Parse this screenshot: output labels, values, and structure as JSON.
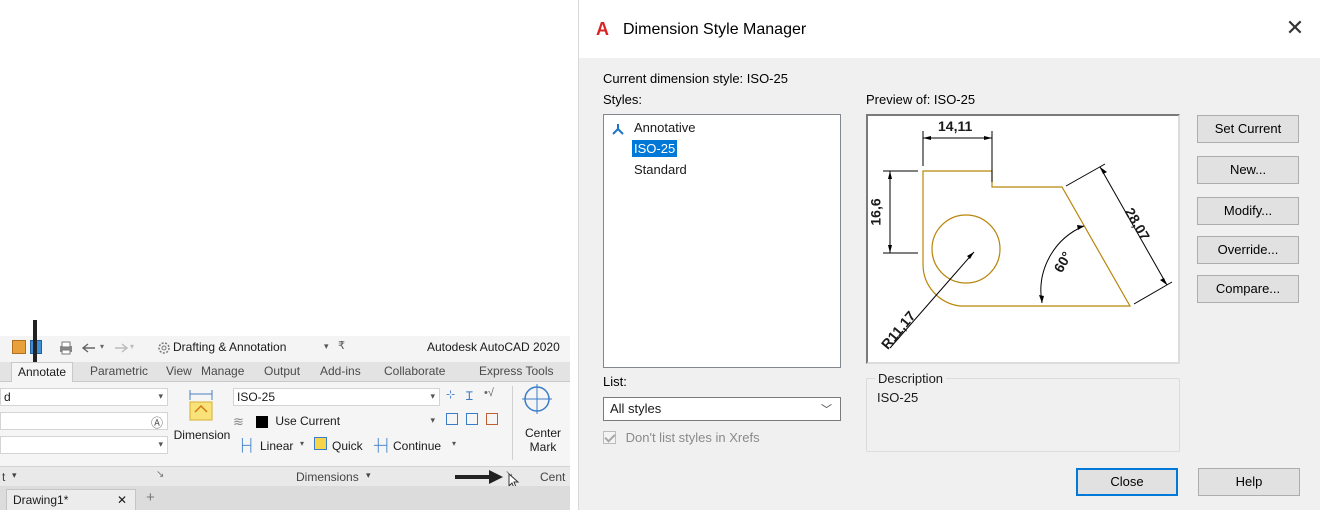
{
  "autocad": {
    "workspace": "Drafting & Annotation",
    "app_title": "Autodesk AutoCAD 2020",
    "tabs": [
      "Annotate",
      "Parametric",
      "View",
      "Manage",
      "Output",
      "Add-ins",
      "Collaborate",
      "Express Tools"
    ],
    "active_tab": "Annotate",
    "dimension_tool_label": "Dimension",
    "dim_style_value": "ISO-25",
    "layer_value": "Use Current",
    "linear_label": "Linear",
    "quick_label": "Quick",
    "continue_label": "Continue",
    "center_mark_label_1": "Center",
    "center_mark_label_2": "Mark",
    "panel_title_dimensions": "Dimensions",
    "panel_title_center": "Cent",
    "panel_title_left": "t",
    "left_text_1": "d",
    "document_tab": "Drawing1*",
    "doc_tab_close": "✕",
    "new_tab": "+"
  },
  "dialog": {
    "title": "Dimension Style Manager",
    "current_style_label": "Current dimension style: ISO-25",
    "styles_label": "Styles:",
    "styles": [
      {
        "name": "Annotative",
        "annotative": true,
        "selected": false
      },
      {
        "name": "ISO-25",
        "annotative": false,
        "selected": true
      },
      {
        "name": "Standard",
        "annotative": false,
        "selected": false
      }
    ],
    "preview_label": "Preview of: ISO-25",
    "preview": {
      "dim_top": "14,11",
      "dim_left": "16,6",
      "dim_right": "28,07",
      "dim_angle": "60°",
      "dim_radius": "R11,17"
    },
    "buttons": {
      "set_current": "Set Current",
      "new": "New...",
      "modify": "Modify...",
      "override": "Override...",
      "compare": "Compare...",
      "close": "Close",
      "help": "Help"
    },
    "list_label": "List:",
    "list_value": "All styles",
    "xref_checkbox_label": "Don't list styles in Xrefs",
    "xref_checked": true,
    "description_label": "Description",
    "description_text": "ISO-25"
  }
}
